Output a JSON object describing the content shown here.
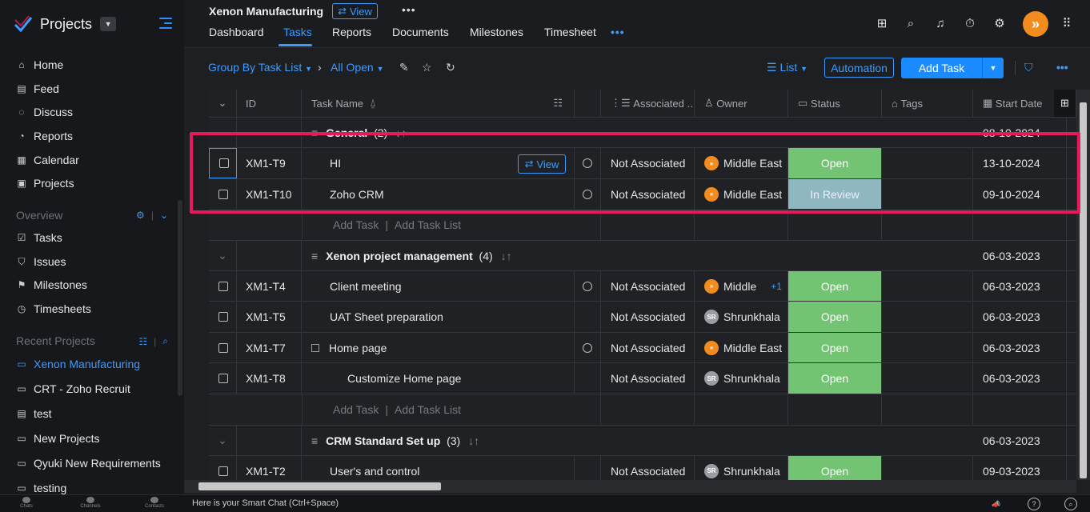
{
  "sidebar": {
    "app_title": "Projects",
    "nav": [
      {
        "label": "Home",
        "icon": "home-icon"
      },
      {
        "label": "Feed",
        "icon": "feed-icon"
      },
      {
        "label": "Discuss",
        "icon": "discuss-icon"
      },
      {
        "label": "Reports",
        "icon": "reports-icon"
      },
      {
        "label": "Calendar",
        "icon": "calendar-icon"
      },
      {
        "label": "Projects",
        "icon": "projects-icon"
      }
    ],
    "overview_label": "Overview",
    "overview": [
      {
        "label": "Tasks",
        "icon": "tasks-icon"
      },
      {
        "label": "Issues",
        "icon": "issues-icon"
      },
      {
        "label": "Milestones",
        "icon": "milestones-icon"
      },
      {
        "label": "Timesheets",
        "icon": "timesheets-icon"
      }
    ],
    "recent_label": "Recent Projects",
    "recent": [
      {
        "label": "Xenon Manufacturing",
        "active": true
      },
      {
        "label": "CRT - Zoho Recruit",
        "active": false
      },
      {
        "label": "test",
        "active": false
      },
      {
        "label": "New Projects",
        "active": false
      },
      {
        "label": "Qyuki New Requirements",
        "active": false
      },
      {
        "label": "testing",
        "active": false
      }
    ]
  },
  "bottom": {
    "tabs": [
      "Chats",
      "Channels",
      "Contacts"
    ],
    "smart_chat": "Here is your Smart Chat (Ctrl+Space)"
  },
  "topbar": {
    "project_title": "Xenon Manufacturing",
    "view_label": "View",
    "tabs": [
      "Dashboard",
      "Tasks",
      "Reports",
      "Documents",
      "Milestones",
      "Timesheet"
    ],
    "active_tab": "Tasks"
  },
  "toolbar": {
    "group_by": "Group By Task List",
    "filter": "All Open",
    "list_label": "List",
    "automation": "Automation",
    "add_task": "Add Task"
  },
  "table": {
    "columns": [
      "ID",
      "Task Name",
      "Associated ...",
      "Owner",
      "Status",
      "Tags",
      "Start Date"
    ],
    "add_task": "Add Task",
    "add_task_list": "Add Task List",
    "view_label": "View",
    "groups": [
      {
        "name": "General",
        "count": "(2)",
        "date": "08-10-2024",
        "tasks": [
          {
            "id": "XM1-T9",
            "name": "HI",
            "assoc": "Not Associated",
            "owner": "Middle East",
            "owner_type": "orange",
            "status": "Open",
            "date": "13-10-2024",
            "timer": true,
            "hover": true
          },
          {
            "id": "XM1-T10",
            "name": "Zoho CRM",
            "assoc": "Not Associated",
            "owner": "Middle East",
            "owner_type": "orange",
            "status": "In Review",
            "date": "09-10-2024",
            "timer": true
          }
        ]
      },
      {
        "name": "Xenon project management",
        "count": "(4)",
        "date": "06-03-2023",
        "tasks": [
          {
            "id": "XM1-T4",
            "name": "Client meeting",
            "assoc": "Not Associated",
            "owner": "Middle",
            "owner_extra": "+1",
            "owner_type": "orange",
            "status": "Open",
            "date": "06-03-2023",
            "timer": true
          },
          {
            "id": "XM1-T5",
            "name": "UAT Sheet preparation",
            "assoc": "Not Associated",
            "owner": "Shrunkhala",
            "owner_type": "grey",
            "status": "Open",
            "date": "06-03-2023",
            "timer": false
          },
          {
            "id": "XM1-T7",
            "name": "Home page",
            "assoc": "Not Associated",
            "owner": "Middle East",
            "owner_type": "orange",
            "status": "Open",
            "date": "06-03-2023",
            "timer": true,
            "subtask_box": true
          },
          {
            "id": "XM1-T8",
            "name": "Customize Home page",
            "assoc": "Not Associated",
            "owner": "Shrunkhala",
            "owner_type": "grey",
            "status": "Open",
            "date": "06-03-2023",
            "timer": false,
            "indent": true
          }
        ]
      },
      {
        "name": "CRM Standard Set up",
        "count": "(3)",
        "date": "06-03-2023",
        "tasks": [
          {
            "id": "XM1-T2",
            "name": "User's and control",
            "assoc": "Not Associated",
            "owner": "Shrunkhala",
            "owner_type": "grey",
            "status": "Open",
            "date": "09-03-2023",
            "timer": false
          }
        ]
      }
    ]
  },
  "colors": {
    "accent": "#3b9cff",
    "open": "#72c472",
    "review": "#8fb7c0",
    "highlight": "#e8185a"
  }
}
